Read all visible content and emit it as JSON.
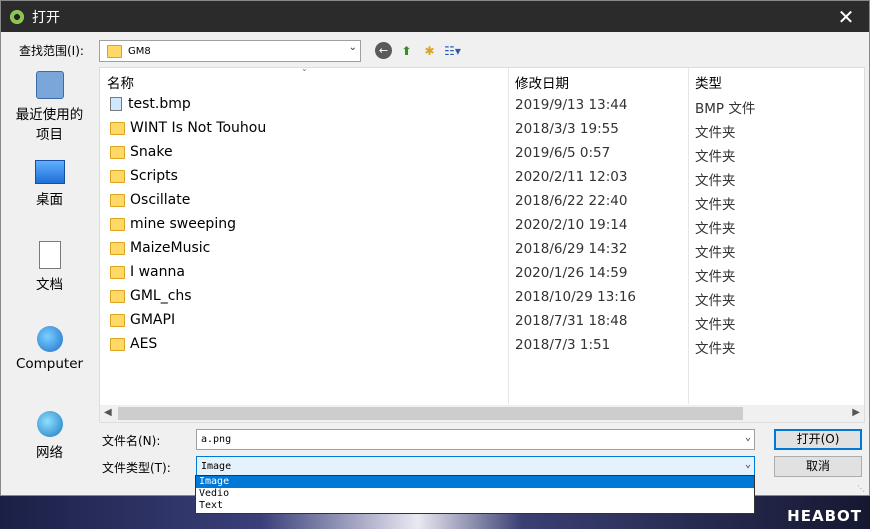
{
  "titlebar": {
    "title": "打开",
    "close": "✕"
  },
  "lookin": {
    "label": "查找范围(I):",
    "value": "GM8"
  },
  "toolbar": {
    "back_icon": "←",
    "up_icon": "⬆",
    "newfolder_icon": "✱",
    "view_icon": "☷▾"
  },
  "places": [
    {
      "label": "最近使用的\n项目",
      "icon": "recent-icon"
    },
    {
      "label": "桌面",
      "icon": "desktop-icon"
    },
    {
      "label": "文档",
      "icon": "documents-icon"
    },
    {
      "label": "Computer",
      "icon": "computer-icon"
    },
    {
      "label": "网络",
      "icon": "network-icon"
    }
  ],
  "columns": {
    "name": "名称",
    "date": "修改日期",
    "type": "类型"
  },
  "files": [
    {
      "name": "test.bmp",
      "date": "2019/9/13 13:44",
      "type": "BMP 文件",
      "kind": "bmp"
    },
    {
      "name": "WINT Is Not Touhou",
      "date": "2018/3/3 19:55",
      "type": "文件夹",
      "kind": "folder"
    },
    {
      "name": "Snake",
      "date": "2019/6/5 0:57",
      "type": "文件夹",
      "kind": "folder"
    },
    {
      "name": "Scripts",
      "date": "2020/2/11 12:03",
      "type": "文件夹",
      "kind": "folder"
    },
    {
      "name": "Oscillate",
      "date": "2018/6/22 22:40",
      "type": "文件夹",
      "kind": "folder"
    },
    {
      "name": "mine sweeping",
      "date": "2020/2/10 19:14",
      "type": "文件夹",
      "kind": "folder"
    },
    {
      "name": "MaizeMusic",
      "date": "2018/6/29 14:32",
      "type": "文件夹",
      "kind": "folder"
    },
    {
      "name": "I wanna",
      "date": "2020/1/26 14:59",
      "type": "文件夹",
      "kind": "folder"
    },
    {
      "name": "GML_chs",
      "date": "2018/10/29 13:16",
      "type": "文件夹",
      "kind": "folder"
    },
    {
      "name": "GMAPI",
      "date": "2018/7/31 18:48",
      "type": "文件夹",
      "kind": "folder"
    },
    {
      "name": "AES",
      "date": "2018/7/3 1:51",
      "type": "文件夹",
      "kind": "folder"
    }
  ],
  "filename": {
    "label": "文件名(N):",
    "value": "a.png"
  },
  "filetype": {
    "label": "文件类型(T):",
    "value": "Image",
    "options": [
      "Image",
      "Vedio",
      "Text"
    ]
  },
  "buttons": {
    "open": "打开(O)",
    "cancel": "取消"
  },
  "watermark": "HEABOT"
}
